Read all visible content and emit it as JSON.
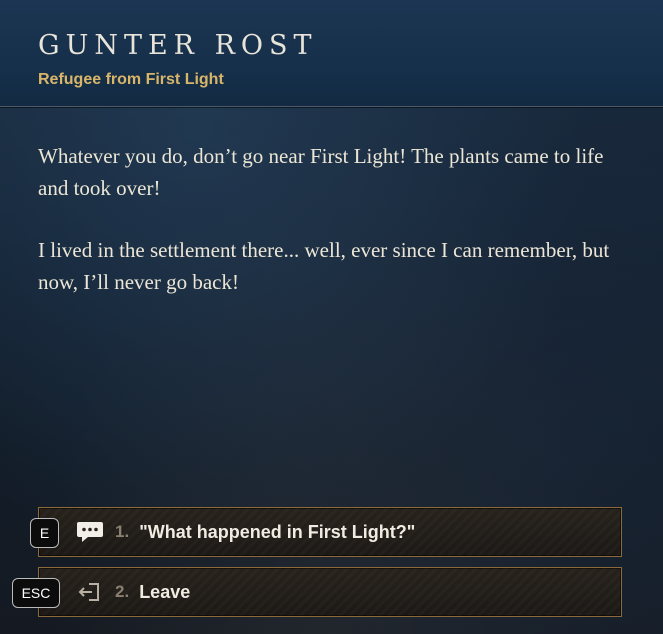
{
  "npc": {
    "name": "GUNTER ROST",
    "title": "Refugee from First Light"
  },
  "dialogue": {
    "paragraphs": [
      "Whatever you do, don’t go near First Light! The plants came to life and took over!",
      "I lived in the settlement there... well, ever since I can remember, but now, I’ll never go back!"
    ]
  },
  "options": [
    {
      "key": "E",
      "number": "1.",
      "label": "\"What happened in First Light?\"",
      "icon": "speech-bubble-icon"
    },
    {
      "key": "ESC",
      "number": "2.",
      "label": "Leave",
      "icon": "exit-door-icon"
    }
  ],
  "colors": {
    "title_gold": "#d9b56a",
    "option_border": "#8a6a3a",
    "header_blue": "#16304b"
  }
}
